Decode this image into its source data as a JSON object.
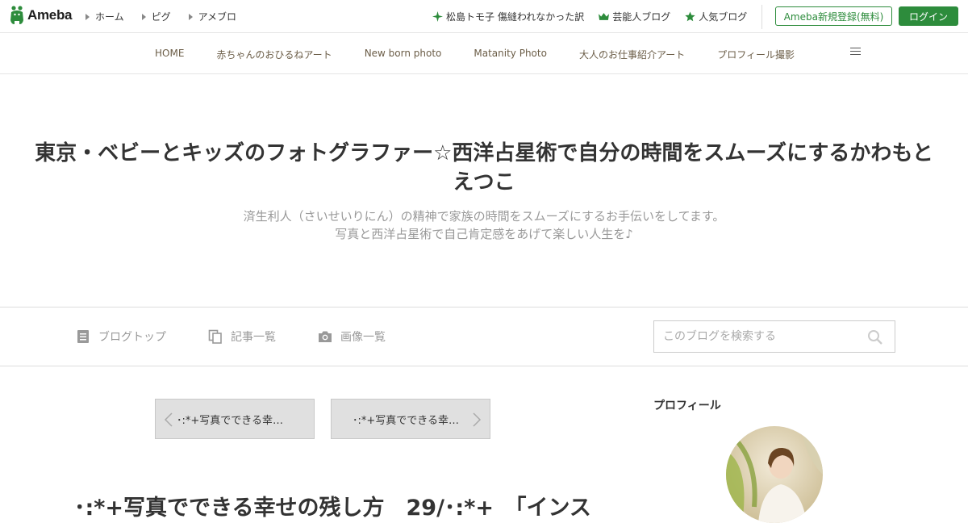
{
  "brand": {
    "logo_text": "Ameba",
    "accent": "#2d8c3c"
  },
  "global_nav": [
    {
      "label": "ホーム"
    },
    {
      "label": "ピグ"
    },
    {
      "label": "アメブロ"
    }
  ],
  "right_nav": [
    {
      "icon": "sparkle-icon",
      "label": "松島トモ子 傷縫われなかった訳"
    },
    {
      "icon": "crown-icon",
      "label": "芸能人ブログ"
    },
    {
      "icon": "star-icon",
      "label": "人気ブログ"
    }
  ],
  "auth": {
    "register_label": "Ameba新規登録(無料)",
    "login_label": "ログイン"
  },
  "blog_nav": [
    {
      "label": "HOME"
    },
    {
      "label": "赤ちゃんのおひるねアート"
    },
    {
      "label": "New born photo"
    },
    {
      "label": "Matanity Photo"
    },
    {
      "label": "大人のお仕事紹介アート"
    },
    {
      "label": "プロフィール撮影"
    }
  ],
  "header": {
    "title": "東京・ベビーとキッズのフォトグラファー☆西洋占星術で自分の時間をスムーズにするかわもとえつこ",
    "description_line1": "済生利人（さいせいりにん）の精神で家族の時間をスムーズにするお手伝いをしてます。",
    "description_line2": "写真と西洋占星術で自己肯定感をあげて楽しい人生を♪"
  },
  "sub_nav": {
    "blog_top": "ブログトップ",
    "entry_list": "記事一覧",
    "image_list": "画像一覧",
    "search_placeholder": "このブログを検索する"
  },
  "pager": {
    "prev_label": "･:*+写真でできる幸せの残し方",
    "next_label": "･:*+写真でできる幸せの残し方"
  },
  "article": {
    "title": "･:*+写真でできる幸せの残し方　29/･:*+　「インス"
  },
  "sidebar": {
    "profile_heading": "プロフィール"
  }
}
